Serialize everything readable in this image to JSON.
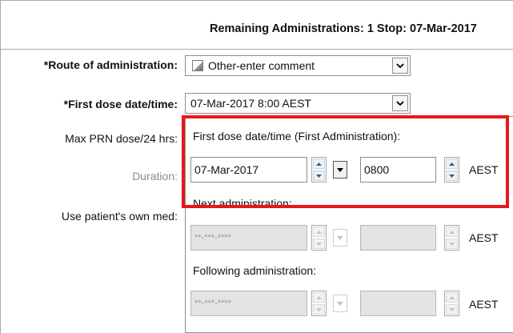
{
  "header": {
    "remaining_text": "Remaining Administrations: 1  Stop: 07-Mar-2017"
  },
  "form": {
    "route_label": "*Route of administration:",
    "route_value": "Other-enter comment",
    "first_dose_label": "*First dose date/time:",
    "first_dose_value": "07-Mar-2017 8:00 AEST",
    "max_prn_label": "Max PRN dose/24 hrs:",
    "duration_label": "Duration:",
    "own_med_label": "Use patient's own med:"
  },
  "popup": {
    "first_admin_label": "First dose date/time (First Administration):",
    "first_admin_date": "07-Mar-2017",
    "first_admin_time": "0800",
    "first_admin_tz": "AEST",
    "next_label": "Next administration:",
    "next_date": "**-***-****",
    "next_tz": "AEST",
    "following_label": "Following administration:",
    "following_date": "**-***-****",
    "following_tz": "AEST"
  },
  "colors": {
    "highlight": "#e8161c"
  }
}
